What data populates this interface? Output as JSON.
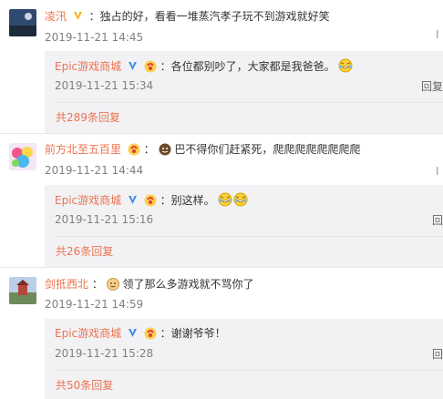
{
  "comments": [
    {
      "user": "凌汛",
      "text": "：独占的好，看看一堆蒸汽孝子玩不到游戏就好笑",
      "time": "2019-11-21 14:45",
      "reply": {
        "user": "Epic游戏商城",
        "text": "：各位都别吵了，大家都是我爸爸。",
        "time": "2019-11-21 15:34",
        "action": "回复"
      },
      "more": "共289条回复"
    },
    {
      "user": "前方北至五百里",
      "text": "巴不得你们赶紧死，爬爬爬爬爬爬爬爬",
      "time": "2019-11-21 14:44",
      "reply": {
        "user": "Epic游戏商城",
        "text": "：别这样。",
        "time": "2019-11-21 15:16",
        "action": "回"
      },
      "more": "共26条回复"
    },
    {
      "user": "剑抵西北",
      "text": "领了那么多游戏就不骂你了",
      "time": "2019-11-21 14:59",
      "reply": {
        "user": "Epic游戏商城",
        "text": "：谢谢爷爷！",
        "time": "2019-11-21 15:28",
        "action": "回"
      },
      "more": "共50条回复"
    }
  ],
  "right_edge": [
    "Ⅰ",
    "Ⅰ"
  ],
  "colors": {
    "username": "#eb7350",
    "reply_bg": "#f2f2f5",
    "time": "#808080"
  }
}
